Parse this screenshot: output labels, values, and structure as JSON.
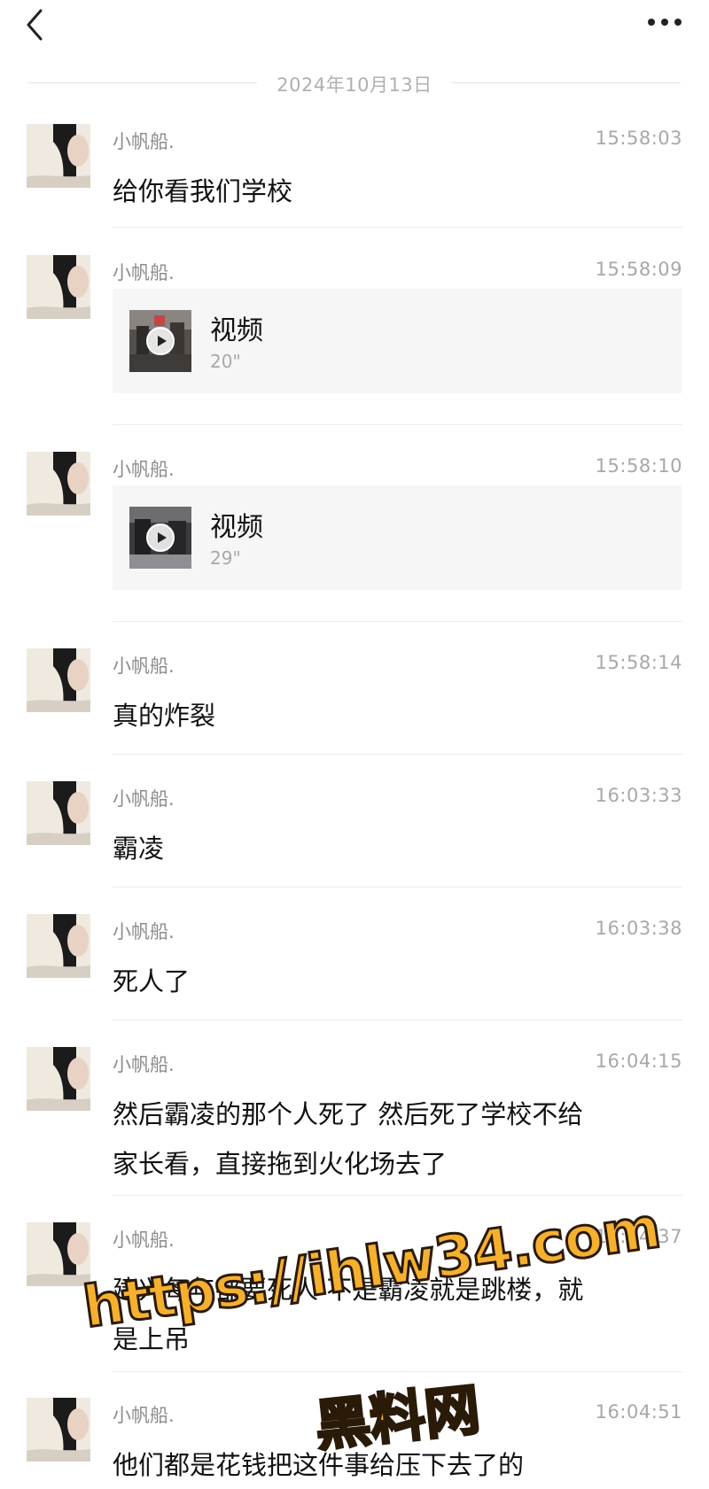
{
  "header": {
    "back_icon": "chevron-left-icon",
    "more_icon": "more-horizontal-icon"
  },
  "date_divider": "2024年10月13日",
  "messages": [
    {
      "sender": "小帆船.",
      "time": "15:58:03",
      "type": "text",
      "text": "给你看我们学校"
    },
    {
      "sender": "小帆船.",
      "time": "15:58:09",
      "type": "video",
      "title": "视频",
      "duration": "20\""
    },
    {
      "sender": "小帆船.",
      "time": "15:58:10",
      "type": "video",
      "title": "视频",
      "duration": "29\""
    },
    {
      "sender": "小帆船.",
      "time": "15:58:14",
      "type": "text",
      "text": "真的炸裂"
    },
    {
      "sender": "小帆船.",
      "time": "16:03:33",
      "type": "text",
      "text": "霸凌"
    },
    {
      "sender": "小帆船.",
      "time": "16:03:38",
      "type": "text",
      "text": "死人了"
    },
    {
      "sender": "小帆船.",
      "time": "16:04:15",
      "type": "text",
      "text_line1": "然后霸凌的那个人死了  然后死了学校不给",
      "text_line2": "家长看，直接拖到火化场去了"
    },
    {
      "sender": "小帆船.",
      "time": "16:04:37",
      "type": "text",
      "text_line1": "建兴每年都要死人  不是霸凌就是跳楼，就",
      "text_line2": "是上吊"
    },
    {
      "sender": "小帆船.",
      "time": "16:04:51",
      "type": "text",
      "text": "他们都是花钱把这件事给压下去了的"
    }
  ],
  "watermark": {
    "url": "https://ihlw34.com",
    "site_name": "黑料网"
  }
}
